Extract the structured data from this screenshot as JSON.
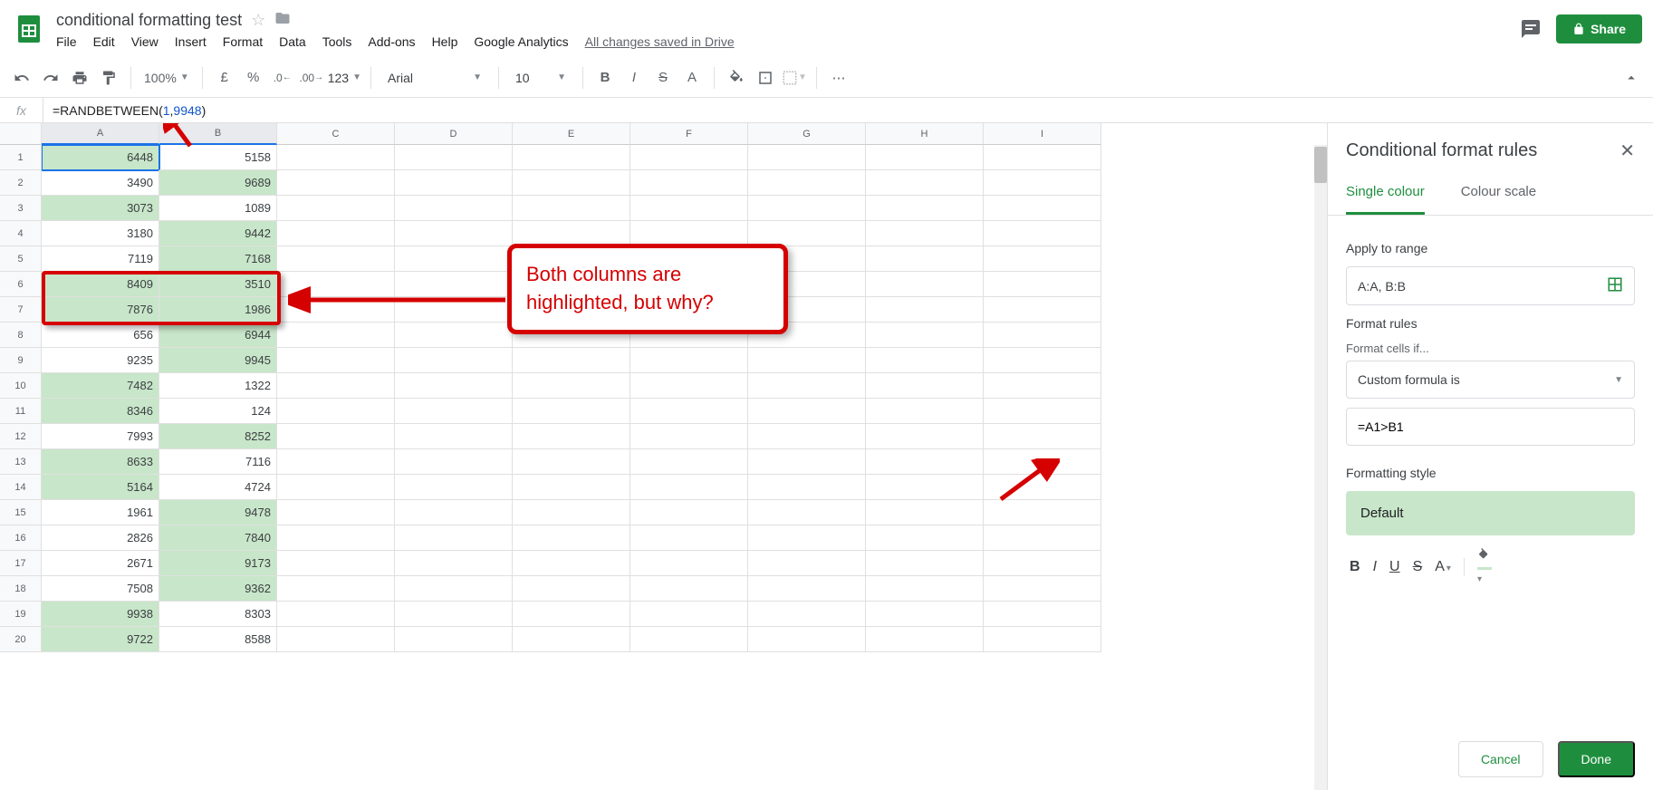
{
  "doc": {
    "title": "conditional formatting test",
    "drive_status": "All changes saved in Drive"
  },
  "menus": [
    "File",
    "Edit",
    "View",
    "Insert",
    "Format",
    "Data",
    "Tools",
    "Add-ons",
    "Help",
    "Google Analytics"
  ],
  "toolbar": {
    "zoom": "100%",
    "currency": "£",
    "percent": "%",
    "dec_dec": ".0",
    "inc_dec": ".00",
    "num_fmt": "123",
    "font": "Arial",
    "font_size": "10"
  },
  "share_label": "Share",
  "formula": {
    "prefix": "=RANDBETWEEN(",
    "arg1": "1",
    "sep": ",",
    "arg2": "9948",
    "suffix": ")"
  },
  "columns": [
    "A",
    "B",
    "C",
    "D",
    "E",
    "F",
    "G",
    "H",
    "I"
  ],
  "rows": [
    1,
    2,
    3,
    4,
    5,
    6,
    7,
    8,
    9,
    10,
    11,
    12,
    13,
    14,
    15,
    16,
    17,
    18,
    19,
    20
  ],
  "chart_data": {
    "type": "table",
    "title": "conditional formatting test data",
    "categories": [
      "A",
      "B"
    ],
    "values": [
      [
        6448,
        5158
      ],
      [
        3490,
        9689
      ],
      [
        3073,
        1089
      ],
      [
        3180,
        9442
      ],
      [
        7119,
        7168
      ],
      [
        8409,
        3510
      ],
      [
        7876,
        1986
      ],
      [
        656,
        6944
      ],
      [
        9235,
        9945
      ],
      [
        7482,
        1322
      ],
      [
        8346,
        124
      ],
      [
        7993,
        8252
      ],
      [
        8633,
        7116
      ],
      [
        5164,
        4724
      ],
      [
        1961,
        9478
      ],
      [
        2826,
        7840
      ],
      [
        2671,
        9173
      ],
      [
        7508,
        9362
      ],
      [
        9938,
        8303
      ],
      [
        9722,
        8588
      ]
    ],
    "highlightA": [
      true,
      false,
      true,
      false,
      false,
      true,
      true,
      false,
      false,
      true,
      true,
      false,
      true,
      true,
      false,
      false,
      false,
      false,
      true,
      true
    ],
    "highlightB": [
      false,
      true,
      false,
      true,
      true,
      true,
      true,
      true,
      true,
      false,
      false,
      true,
      false,
      false,
      true,
      true,
      true,
      true,
      false,
      false
    ]
  },
  "annotation": {
    "callout": "Both columns are highlighted, but why?"
  },
  "sidepanel": {
    "title": "Conditional format rules",
    "tab_single": "Single colour",
    "tab_scale": "Colour scale",
    "apply_range_label": "Apply to range",
    "range_value": "A:A, B:B",
    "format_rules_label": "Format rules",
    "format_cells_if_label": "Format cells if...",
    "rule_type": "Custom formula is",
    "formula_value": "=A1>B1",
    "style_label": "Formatting style",
    "style_preview": "Default",
    "cancel": "Cancel",
    "done": "Done"
  }
}
